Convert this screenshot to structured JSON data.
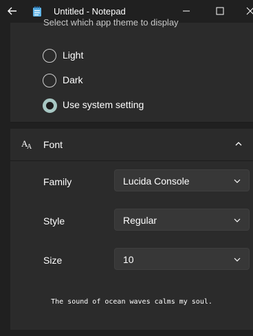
{
  "window": {
    "title": "Untitled - Notepad",
    "icons": {
      "back": "back-arrow-icon",
      "app": "notepad-icon",
      "minimize": "minimize-icon",
      "maximize": "maximize-icon",
      "close": "close-icon"
    }
  },
  "theme": {
    "description": "Select which app theme to display",
    "options": [
      {
        "label": "Light",
        "selected": false
      },
      {
        "label": "Dark",
        "selected": false
      },
      {
        "label": "Use system setting",
        "selected": true
      }
    ]
  },
  "font": {
    "title": "Font",
    "icon": "font-size-icon",
    "expanded": true,
    "family": {
      "label": "Family",
      "value": "Lucida Console"
    },
    "style": {
      "label": "Style",
      "value": "Regular"
    },
    "size": {
      "label": "Size",
      "value": "10"
    },
    "preview": "The sound of ocean waves calms my soul."
  },
  "colors": {
    "accent": "#a7c7c3",
    "background": "#202020",
    "panel": "#2b2b2b",
    "control": "#373737"
  }
}
